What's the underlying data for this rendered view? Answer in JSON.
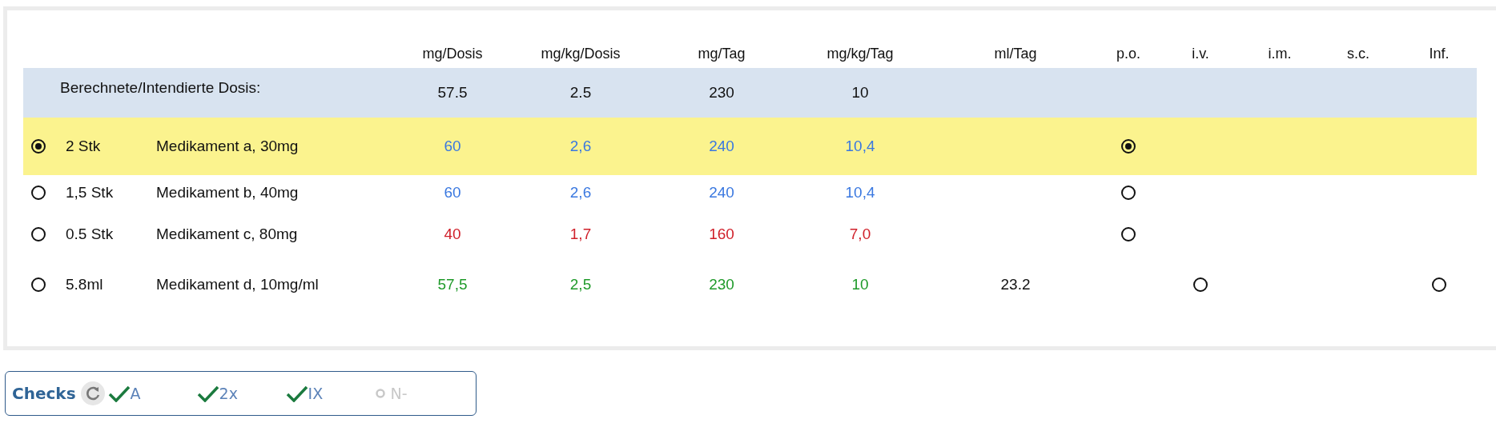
{
  "table": {
    "columns": [
      "mg/Dosis",
      "mg/kg/Dosis",
      "mg/Tag",
      "mg/kg/Tag",
      "ml/Tag",
      "p.o.",
      "i.v.",
      "i.m.",
      "s.c.",
      "Inf."
    ],
    "target": {
      "label": "Berechnete/Intendierte Dosis:",
      "values": [
        "57.5",
        "2.5",
        "230",
        "10"
      ]
    },
    "rows": [
      {
        "selected": true,
        "quantity": "2 Stk",
        "name": "Medikament a, 30mg",
        "color": "#3a78e0",
        "values": [
          "60",
          "2,6",
          "240",
          "10,4"
        ],
        "ml_per_day": null,
        "routes": [
          {
            "kind": "radio",
            "selected": true
          },
          {
            "kind": "empty"
          },
          {
            "kind": "empty"
          },
          {
            "kind": "empty"
          },
          {
            "kind": "empty"
          }
        ]
      },
      {
        "selected": false,
        "quantity": "1,5 Stk",
        "name": "Medikament b, 40mg",
        "color": "#3a78e0",
        "values": [
          "60",
          "2,6",
          "240",
          "10,4"
        ],
        "ml_per_day": null,
        "routes": [
          {
            "kind": "radio",
            "selected": false
          },
          {
            "kind": "empty"
          },
          {
            "kind": "empty"
          },
          {
            "kind": "empty"
          },
          {
            "kind": "empty"
          }
        ]
      },
      {
        "selected": false,
        "quantity": "0.5 Stk",
        "name": "Medikament c, 80mg",
        "color": "#d0202a",
        "values": [
          "40",
          "1,7",
          "160",
          "7,0"
        ],
        "ml_per_day": null,
        "routes": [
          {
            "kind": "radio",
            "selected": false
          },
          {
            "kind": "empty"
          },
          {
            "kind": "empty"
          },
          {
            "kind": "empty"
          },
          {
            "kind": "empty"
          }
        ]
      },
      {
        "selected": false,
        "quantity": "5.8ml",
        "name": "Medikament d, 10mg/ml",
        "color": "#1f9a2a",
        "values": [
          "57,5",
          "2,5",
          "230",
          "10"
        ],
        "ml_per_day": "23.2",
        "routes": [
          {
            "kind": "empty"
          },
          {
            "kind": "radio",
            "selected": false
          },
          {
            "kind": "empty"
          },
          {
            "kind": "empty"
          },
          {
            "kind": "radio",
            "selected": false
          }
        ]
      }
    ]
  },
  "checks": {
    "label": "Checks",
    "items": [
      {
        "label": "A",
        "passed": true
      },
      {
        "label": "2x",
        "passed": true
      },
      {
        "label": "IX",
        "passed": true
      },
      {
        "label": "N-",
        "passed": false
      }
    ]
  }
}
